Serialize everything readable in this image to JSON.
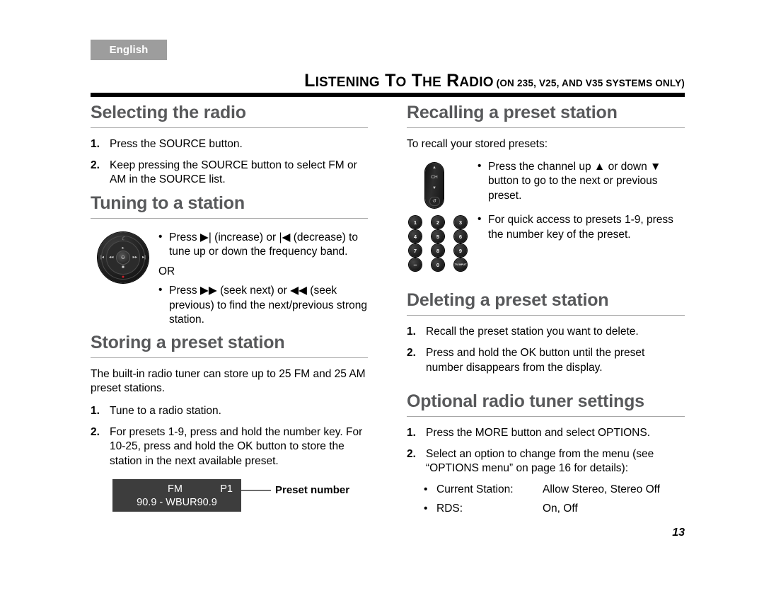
{
  "language_tab": {
    "label": "English"
  },
  "running_head": {
    "part1_cap": "L",
    "part1_rest": "ISTENING",
    "part2_cap": "",
    "word_to_cap": "T",
    "word_to_rest": "O",
    "word_the_cap": "T",
    "word_the_rest": "HE",
    "part3_cap": "R",
    "part3_rest": "ADIO",
    "suffix": "(ON 235, V25, AND V35 SYSTEMS ONLY)",
    "full_text": "LISTENING TO THE RADIO (ON 235, V25, AND V35 SYSTEMS ONLY)"
  },
  "left_column": {
    "selecting_radio": {
      "heading": "Selecting the radio",
      "steps": [
        {
          "num": "1.",
          "text": "Press the SOURCE button."
        },
        {
          "num": "2.",
          "text": "Keep pressing the SOURCE button to select FM or AM in the SOURCE list."
        }
      ]
    },
    "tuning_station": {
      "heading": "Tuning to a station",
      "bullet1": "Press ▶| (increase) or |◀ (decrease) to tune up or down the frequency band.",
      "or_label": "OR",
      "bullet2": "Press ▶▶ (seek next) or ◀◀ (seek previous) to find the next/previous strong station.",
      "jog_dial": {
        "center_glyph": "⎉",
        "play_glyph": "▸",
        "stop_glyph": "■",
        "rew_glyph": "◂◂",
        "ffwd_glyph": "▸▸",
        "prev_glyph": "|◂",
        "next_glyph": "▸|",
        "logo": "ℂ",
        "record_dot": "●"
      }
    },
    "storing_preset": {
      "heading": "Storing a preset station",
      "intro": "The built-in radio tuner can store up to 25 FM and 25 AM preset stations.",
      "steps": [
        {
          "num": "1.",
          "text": "Tune to a radio station."
        },
        {
          "num": "2.",
          "text": "For presets 1-9, press and hold the number key. For 10-25, press and hold the OK button to store the station in the next available preset."
        }
      ],
      "display": {
        "band": "FM",
        "preset": "P1",
        "station": "90.9 - WBUR90.9",
        "callout": "Preset number"
      }
    }
  },
  "right_column": {
    "recalling_preset": {
      "heading": "Recalling a preset station",
      "intro": "To recall your stored presets:",
      "bullet1": "Press the channel up ▲ or down ▼ button to go to the next or previous preset.",
      "bullet2": "For quick access to presets 1-9, press the number key of the preset.",
      "ch_strip": {
        "up_glyph": "▲",
        "label": "CH",
        "down_glyph": "▼",
        "return_glyph": "↺"
      },
      "keypad": {
        "keys": [
          "1",
          "2",
          "3",
          "4",
          "5",
          "6",
          "7",
          "8",
          "9",
          "–",
          "0",
          "TV INPUT"
        ]
      }
    },
    "deleting_preset": {
      "heading": "Deleting a preset station",
      "steps": [
        {
          "num": "1.",
          "text": "Recall the preset station you want to delete."
        },
        {
          "num": "2.",
          "text": "Press and hold the OK button until the preset number disappears from the display."
        }
      ]
    },
    "optional_settings": {
      "heading": "Optional radio tuner settings",
      "steps": [
        {
          "num": "1.",
          "text": "Press the MORE button and select OPTIONS."
        },
        {
          "num": "2.",
          "text": "Select an option to change from the menu (see “OPTIONS menu” on page 16 for details):"
        }
      ],
      "options": [
        {
          "label": "Current Station:",
          "value": "Allow Stereo, Stereo Off"
        },
        {
          "label": "RDS:",
          "value": "On, Off"
        }
      ]
    }
  },
  "page_number": "13",
  "colors": {
    "heading": "#58595b",
    "tab_bg": "#9d9d9d",
    "display_bg": "#3d3d3d",
    "rule": "#a7a7a7",
    "record_red": "#d1202a"
  }
}
